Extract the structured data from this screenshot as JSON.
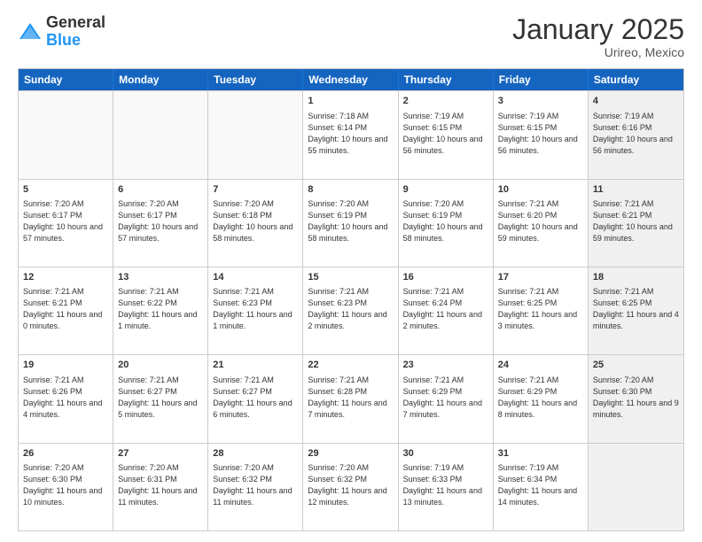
{
  "logo": {
    "general": "General",
    "blue": "Blue"
  },
  "header": {
    "month": "January 2025",
    "location": "Urireo, Mexico"
  },
  "weekdays": [
    "Sunday",
    "Monday",
    "Tuesday",
    "Wednesday",
    "Thursday",
    "Friday",
    "Saturday"
  ],
  "rows": [
    [
      {
        "day": "",
        "info": "",
        "empty": true
      },
      {
        "day": "",
        "info": "",
        "empty": true
      },
      {
        "day": "",
        "info": "",
        "empty": true
      },
      {
        "day": "1",
        "info": "Sunrise: 7:18 AM\nSunset: 6:14 PM\nDaylight: 10 hours and 55 minutes.",
        "empty": false
      },
      {
        "day": "2",
        "info": "Sunrise: 7:19 AM\nSunset: 6:15 PM\nDaylight: 10 hours and 56 minutes.",
        "empty": false
      },
      {
        "day": "3",
        "info": "Sunrise: 7:19 AM\nSunset: 6:15 PM\nDaylight: 10 hours and 56 minutes.",
        "empty": false
      },
      {
        "day": "4",
        "info": "Sunrise: 7:19 AM\nSunset: 6:16 PM\nDaylight: 10 hours and 56 minutes.",
        "empty": false,
        "shaded": true
      }
    ],
    [
      {
        "day": "5",
        "info": "Sunrise: 7:20 AM\nSunset: 6:17 PM\nDaylight: 10 hours and 57 minutes.",
        "empty": false
      },
      {
        "day": "6",
        "info": "Sunrise: 7:20 AM\nSunset: 6:17 PM\nDaylight: 10 hours and 57 minutes.",
        "empty": false
      },
      {
        "day": "7",
        "info": "Sunrise: 7:20 AM\nSunset: 6:18 PM\nDaylight: 10 hours and 58 minutes.",
        "empty": false
      },
      {
        "day": "8",
        "info": "Sunrise: 7:20 AM\nSunset: 6:19 PM\nDaylight: 10 hours and 58 minutes.",
        "empty": false
      },
      {
        "day": "9",
        "info": "Sunrise: 7:20 AM\nSunset: 6:19 PM\nDaylight: 10 hours and 58 minutes.",
        "empty": false
      },
      {
        "day": "10",
        "info": "Sunrise: 7:21 AM\nSunset: 6:20 PM\nDaylight: 10 hours and 59 minutes.",
        "empty": false
      },
      {
        "day": "11",
        "info": "Sunrise: 7:21 AM\nSunset: 6:21 PM\nDaylight: 10 hours and 59 minutes.",
        "empty": false,
        "shaded": true
      }
    ],
    [
      {
        "day": "12",
        "info": "Sunrise: 7:21 AM\nSunset: 6:21 PM\nDaylight: 11 hours and 0 minutes.",
        "empty": false
      },
      {
        "day": "13",
        "info": "Sunrise: 7:21 AM\nSunset: 6:22 PM\nDaylight: 11 hours and 1 minute.",
        "empty": false
      },
      {
        "day": "14",
        "info": "Sunrise: 7:21 AM\nSunset: 6:23 PM\nDaylight: 11 hours and 1 minute.",
        "empty": false
      },
      {
        "day": "15",
        "info": "Sunrise: 7:21 AM\nSunset: 6:23 PM\nDaylight: 11 hours and 2 minutes.",
        "empty": false
      },
      {
        "day": "16",
        "info": "Sunrise: 7:21 AM\nSunset: 6:24 PM\nDaylight: 11 hours and 2 minutes.",
        "empty": false
      },
      {
        "day": "17",
        "info": "Sunrise: 7:21 AM\nSunset: 6:25 PM\nDaylight: 11 hours and 3 minutes.",
        "empty": false
      },
      {
        "day": "18",
        "info": "Sunrise: 7:21 AM\nSunset: 6:25 PM\nDaylight: 11 hours and 4 minutes.",
        "empty": false,
        "shaded": true
      }
    ],
    [
      {
        "day": "19",
        "info": "Sunrise: 7:21 AM\nSunset: 6:26 PM\nDaylight: 11 hours and 4 minutes.",
        "empty": false
      },
      {
        "day": "20",
        "info": "Sunrise: 7:21 AM\nSunset: 6:27 PM\nDaylight: 11 hours and 5 minutes.",
        "empty": false
      },
      {
        "day": "21",
        "info": "Sunrise: 7:21 AM\nSunset: 6:27 PM\nDaylight: 11 hours and 6 minutes.",
        "empty": false
      },
      {
        "day": "22",
        "info": "Sunrise: 7:21 AM\nSunset: 6:28 PM\nDaylight: 11 hours and 7 minutes.",
        "empty": false
      },
      {
        "day": "23",
        "info": "Sunrise: 7:21 AM\nSunset: 6:29 PM\nDaylight: 11 hours and 7 minutes.",
        "empty": false
      },
      {
        "day": "24",
        "info": "Sunrise: 7:21 AM\nSunset: 6:29 PM\nDaylight: 11 hours and 8 minutes.",
        "empty": false
      },
      {
        "day": "25",
        "info": "Sunrise: 7:20 AM\nSunset: 6:30 PM\nDaylight: 11 hours and 9 minutes.",
        "empty": false,
        "shaded": true
      }
    ],
    [
      {
        "day": "26",
        "info": "Sunrise: 7:20 AM\nSunset: 6:30 PM\nDaylight: 11 hours and 10 minutes.",
        "empty": false
      },
      {
        "day": "27",
        "info": "Sunrise: 7:20 AM\nSunset: 6:31 PM\nDaylight: 11 hours and 11 minutes.",
        "empty": false
      },
      {
        "day": "28",
        "info": "Sunrise: 7:20 AM\nSunset: 6:32 PM\nDaylight: 11 hours and 11 minutes.",
        "empty": false
      },
      {
        "day": "29",
        "info": "Sunrise: 7:20 AM\nSunset: 6:32 PM\nDaylight: 11 hours and 12 minutes.",
        "empty": false
      },
      {
        "day": "30",
        "info": "Sunrise: 7:19 AM\nSunset: 6:33 PM\nDaylight: 11 hours and 13 minutes.",
        "empty": false
      },
      {
        "day": "31",
        "info": "Sunrise: 7:19 AM\nSunset: 6:34 PM\nDaylight: 11 hours and 14 minutes.",
        "empty": false
      },
      {
        "day": "",
        "info": "",
        "empty": true,
        "shaded": true
      }
    ]
  ]
}
